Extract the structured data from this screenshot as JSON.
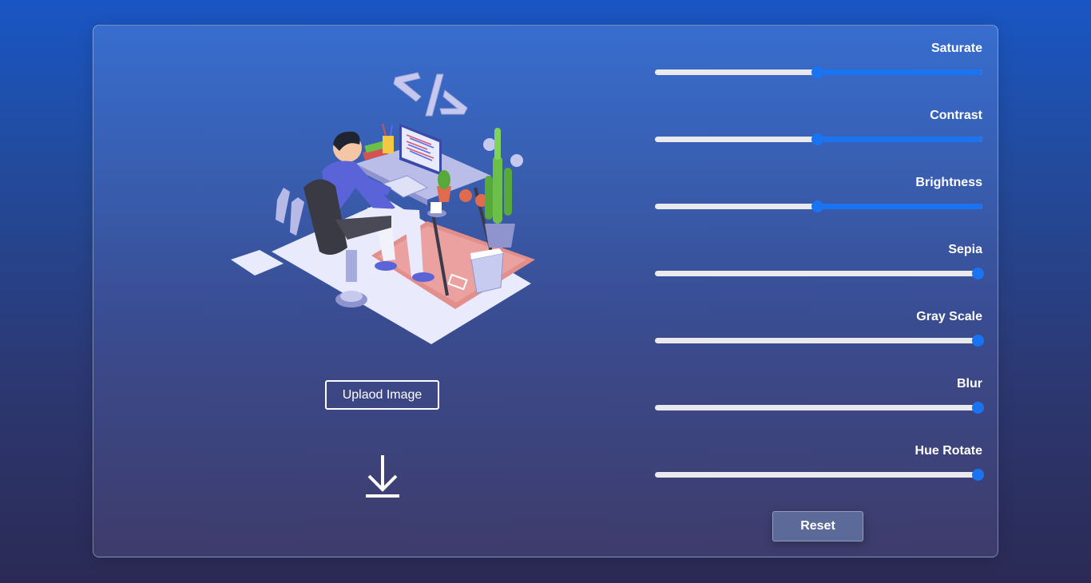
{
  "upload_label": "Uplaod Image",
  "reset_label": "Reset",
  "colors": {
    "accent": "#1a73f0",
    "track": "#e9e9ee",
    "reset_bg": "#5b6a98"
  },
  "icons": {
    "download": "download-icon",
    "illustration": "developer-at-desk-illustration"
  },
  "sliders": [
    {
      "label": "Saturate",
      "value": 0.5
    },
    {
      "label": "Contrast",
      "value": 0.5
    },
    {
      "label": "Brightness",
      "value": 0.5
    },
    {
      "label": "Sepia",
      "value": 0.0
    },
    {
      "label": "Gray Scale",
      "value": 0.0
    },
    {
      "label": "Blur",
      "value": 0.0
    },
    {
      "label": "Hue Rotate",
      "value": 0.0
    }
  ]
}
